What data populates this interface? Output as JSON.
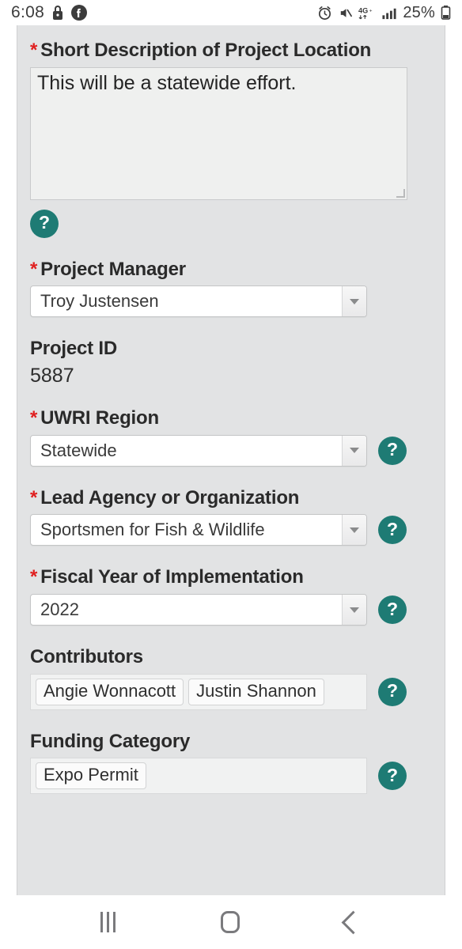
{
  "status_bar": {
    "time": "6:08",
    "left_icons": [
      "lock-icon",
      "facebook-icon"
    ],
    "right_icons": [
      "alarm-icon",
      "mute-icon",
      "4g-plus-icon",
      "signal-bars-icon",
      "battery-icon"
    ],
    "network_label": "4G+",
    "battery_percent": "25%"
  },
  "theme": {
    "accent_teal": "#1e7b74",
    "required_red": "#e02020",
    "page_bg": "#e2e3e4",
    "field_bg": "#eff0ef"
  },
  "form": {
    "required_marker": "*",
    "fields": [
      {
        "label": "Short Description of Project Location",
        "required": true,
        "type": "textarea",
        "value": "This will be a statewide effort.",
        "help": "?"
      },
      {
        "label": "Project Manager",
        "required": true,
        "type": "select",
        "value": "Troy Justensen"
      },
      {
        "label": "Project ID",
        "required": false,
        "type": "static",
        "value": "5887"
      },
      {
        "label": "UWRI Region",
        "required": true,
        "type": "select",
        "value": "Statewide",
        "help": "?"
      },
      {
        "label": "Lead Agency or Organization",
        "required": true,
        "type": "select",
        "value": "Sportsmen for Fish & Wildlife",
        "help": "?"
      },
      {
        "label": "Fiscal Year of Implementation",
        "required": true,
        "type": "select",
        "value": "2022",
        "help": "?"
      },
      {
        "label": "Contributors",
        "required": false,
        "type": "chips",
        "chips": [
          "Angie Wonnacott",
          "Justin Shannon"
        ],
        "help": "?"
      },
      {
        "label": "Funding Category",
        "required": false,
        "type": "chips",
        "chips": [
          "Expo Permit"
        ],
        "help": "?"
      }
    ]
  },
  "nav_bar": {
    "recents_label": "recents-button",
    "home_label": "home-button",
    "back_label": "back-button"
  }
}
